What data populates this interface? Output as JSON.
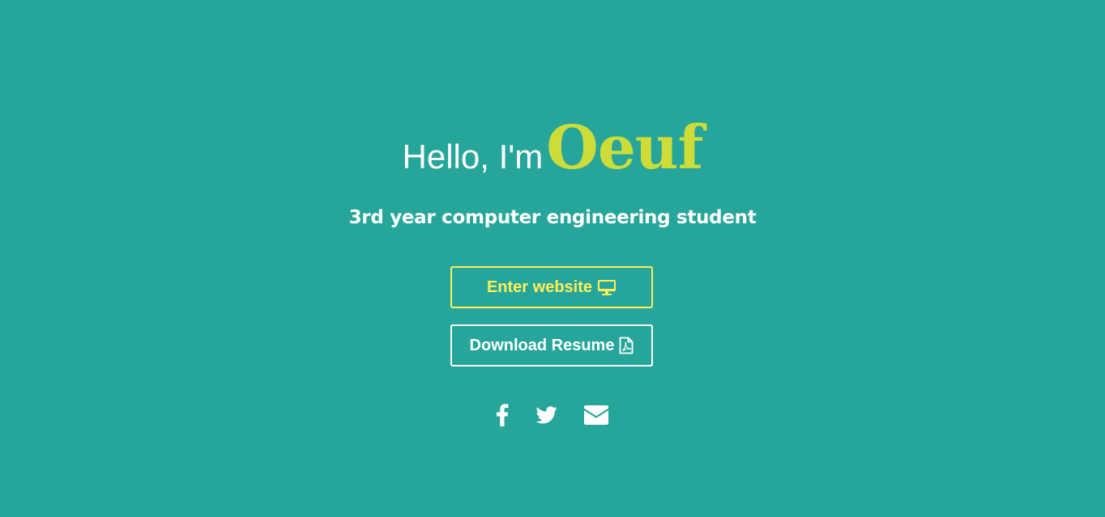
{
  "hero": {
    "greeting": "Hello, I'm",
    "name": "Oeuf",
    "subtitle": "3rd year computer engineering student"
  },
  "buttons": {
    "enter_label": "Enter website",
    "enter_icon": "desktop-icon",
    "resume_label": "Download Resume",
    "resume_icon": "file-pdf-icon"
  },
  "socials": [
    {
      "name": "facebook",
      "icon": "facebook-icon"
    },
    {
      "name": "twitter",
      "icon": "twitter-icon"
    },
    {
      "name": "email",
      "icon": "envelope-icon"
    }
  ],
  "colors": {
    "background": "#26a69a",
    "name_accent": "#cddc39",
    "enter_button": "#ffee58",
    "text": "#ffffff"
  }
}
